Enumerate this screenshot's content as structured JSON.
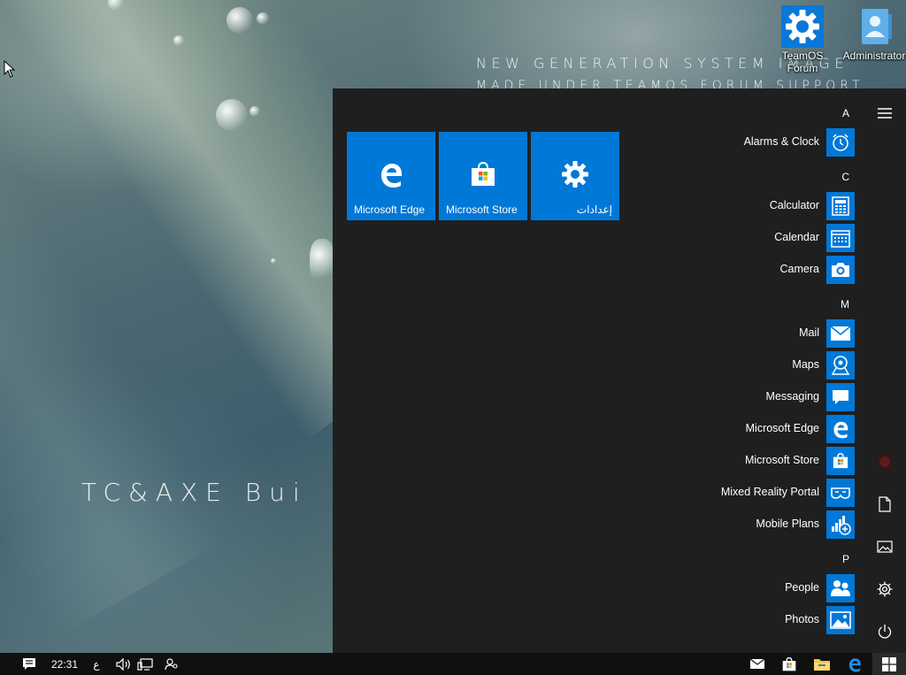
{
  "wallpaper": {
    "line1": "NEW GENERATION SYSTEM IMAGE",
    "line2": "MADE UNDER TEAMOS FORUM SUPPORT",
    "line3": "TC&AXE Bui"
  },
  "desktop_icons": [
    {
      "label": "TeamOS Forum",
      "icon": "gear-icon"
    },
    {
      "label": "Administrator",
      "icon": "user-folder-icon"
    }
  ],
  "start_menu": {
    "tiles": [
      {
        "label": "Microsoft Edge",
        "icon": "edge-icon"
      },
      {
        "label": "Microsoft Store",
        "icon": "store-icon"
      },
      {
        "label": "إعدادات",
        "icon": "settings-gear-icon"
      }
    ],
    "groups": [
      {
        "letter": "A",
        "apps": [
          {
            "name": "Alarms & Clock",
            "icon": "alarm-clock-icon"
          }
        ]
      },
      {
        "letter": "C",
        "apps": [
          {
            "name": "Calculator",
            "icon": "calculator-icon"
          },
          {
            "name": "Calendar",
            "icon": "calendar-icon"
          },
          {
            "name": "Camera",
            "icon": "camera-icon"
          }
        ]
      },
      {
        "letter": "M",
        "apps": [
          {
            "name": "Mail",
            "icon": "mail-icon"
          },
          {
            "name": "Maps",
            "icon": "maps-icon"
          },
          {
            "name": "Messaging",
            "icon": "messaging-icon"
          },
          {
            "name": "Microsoft Edge",
            "icon": "edge-icon"
          },
          {
            "name": "Microsoft Store",
            "icon": "store-icon"
          },
          {
            "name": "Mixed Reality Portal",
            "icon": "mixed-reality-icon"
          },
          {
            "name": "Mobile Plans",
            "icon": "mobile-plans-icon"
          }
        ]
      },
      {
        "letter": "P",
        "apps": [
          {
            "name": "People",
            "icon": "people-icon"
          },
          {
            "name": "Photos",
            "icon": "photos-icon"
          }
        ]
      }
    ],
    "rail": [
      "hamburger-menu-icon",
      "user-avatar-icon",
      "documents-icon",
      "pictures-icon",
      "settings-icon",
      "power-icon"
    ]
  },
  "taskbar": {
    "clock": "22:31",
    "language": "ع",
    "tray_icons": [
      "action-center-icon",
      "volume-icon",
      "network-icon",
      "people-icon"
    ],
    "pinned": [
      "mail-icon",
      "store-icon",
      "file-explorer-icon",
      "edge-icon",
      "windows-start-icon"
    ]
  },
  "colors": {
    "accent": "#0078d7",
    "menu_bg": "#1f1f1f",
    "taskbar_bg": "#101010"
  }
}
